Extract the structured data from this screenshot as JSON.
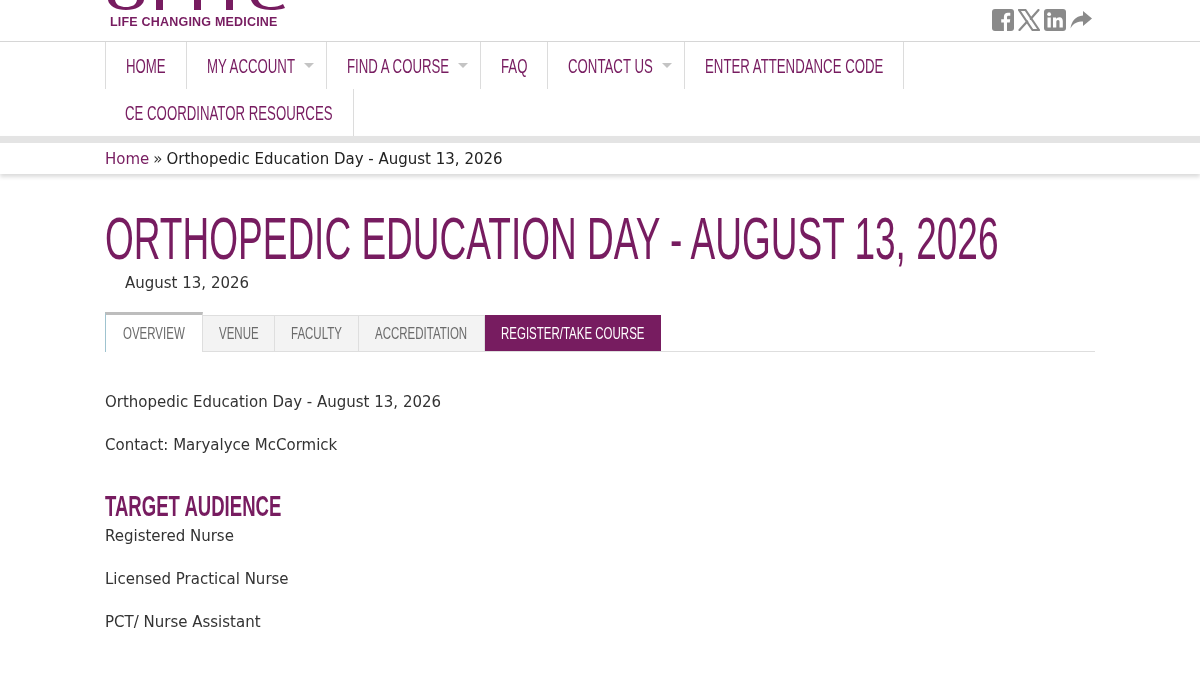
{
  "header": {
    "tagline": "LIFE CHANGING MEDICINE"
  },
  "nav": [
    {
      "label": "HOME",
      "has_dropdown": false
    },
    {
      "label": "MY ACCOUNT",
      "has_dropdown": true
    },
    {
      "label": "FIND A COURSE",
      "has_dropdown": true
    },
    {
      "label": "FAQ",
      "has_dropdown": false
    },
    {
      "label": "CONTACT US",
      "has_dropdown": true
    },
    {
      "label": "ENTER ATTENDANCE CODE",
      "has_dropdown": false
    },
    {
      "label": "CE COORDINATOR RESOURCES",
      "has_dropdown": false
    }
  ],
  "breadcrumb": [
    {
      "label": "Home",
      "kind": "link"
    },
    {
      "label": "»",
      "kind": "separator"
    },
    {
      "label": "Orthopedic Education Day - August 13, 2026",
      "kind": "current"
    }
  ],
  "page": {
    "title": "ORTHOPEDIC EDUCATION DAY - AUGUST 13, 2026",
    "date": "August 13, 2026"
  },
  "tabs": [
    {
      "label": "OVERVIEW",
      "kind": "tab",
      "selected": true
    },
    {
      "label": "VENUE",
      "kind": "tab",
      "selected": false
    },
    {
      "label": "FACULTY",
      "kind": "tab",
      "selected": false
    },
    {
      "label": "ACCREDITATION",
      "kind": "tab",
      "selected": false
    },
    {
      "label": "REGISTER/TAKE COURSE",
      "kind": "action",
      "selected": false
    }
  ],
  "content": {
    "paragraphs": [
      "Orthopedic Education Day - August 13, 2026",
      "Contact: Maryalyce McCormick"
    ],
    "sections": [
      {
        "heading": "TARGET AUDIENCE",
        "items": [
          "Registered Nurse",
          "Licensed Practical Nurse",
          "PCT/ Nurse Assistant"
        ]
      }
    ]
  }
}
